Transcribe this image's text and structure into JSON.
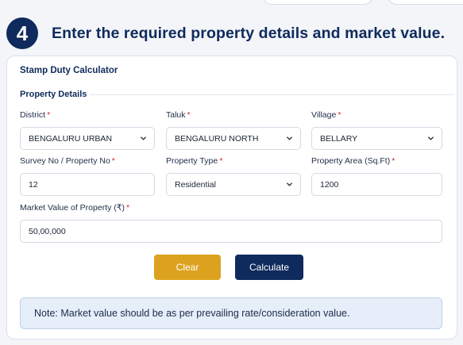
{
  "step": {
    "number": "4",
    "title": "Enter the required property details and market value."
  },
  "calculator": {
    "title": "Stamp Duty Calculator",
    "section_title": "Property Details",
    "required_mark": "*",
    "fields": {
      "district": {
        "label": "District",
        "value": "BENGALURU URBAN",
        "icon": "chevron-down-icon"
      },
      "taluk": {
        "label": "Taluk",
        "value": "BENGALURU NORTH",
        "icon": "chevron-down-icon"
      },
      "village": {
        "label": "Village",
        "value": "BELLARY",
        "icon": "chevron-down-icon"
      },
      "survey_no": {
        "label": "Survey No / Property No",
        "value": "12"
      },
      "property_type": {
        "label": "Property Type",
        "value": "Residential",
        "icon": "chevron-down-icon"
      },
      "property_area": {
        "label": "Property Area (Sq.Ft)",
        "value": "1200"
      },
      "market_value": {
        "label": "Market Value of Property (₹)",
        "value": "50,00,000"
      }
    },
    "buttons": {
      "clear": "Clear",
      "calculate": "Calculate"
    },
    "note": "Note: Market value should be as per prevailing rate/consideration value."
  },
  "colors": {
    "primary": "#0f2a5c",
    "accent": "#dca21f",
    "required": "#d8262b",
    "note_bg": "#e6eef9"
  }
}
